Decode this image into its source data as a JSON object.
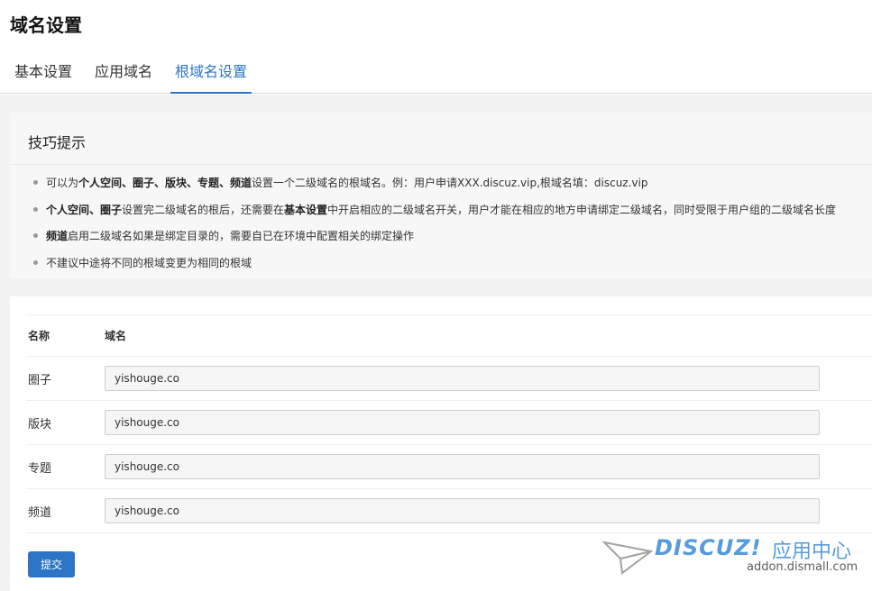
{
  "page": {
    "title": "域名设置"
  },
  "tabs": [
    {
      "label": "基本设置",
      "active": false
    },
    {
      "label": "应用域名",
      "active": false
    },
    {
      "label": "根域名设置",
      "active": true
    }
  ],
  "tips": {
    "title": "技巧提示",
    "items": [
      {
        "parts": [
          {
            "text": "可以为",
            "bold": false
          },
          {
            "text": "个人空间、圈子、版块、专题、频道",
            "bold": true
          },
          {
            "text": "设置一个二级域名的根域名。例：用户申请XXX.discuz.vip,根域名填：discuz.vip",
            "bold": false
          }
        ]
      },
      {
        "parts": [
          {
            "text": "个人空间、圈子",
            "bold": true
          },
          {
            "text": "设置完二级域名的根后，还需要在",
            "bold": false
          },
          {
            "text": "基本设置",
            "bold": true
          },
          {
            "text": "中开启相应的二级域名开关，用户才能在相应的地方申请绑定二级域名，同时受限于用户组的二级域名长度",
            "bold": false
          }
        ]
      },
      {
        "parts": [
          {
            "text": "频道",
            "bold": true
          },
          {
            "text": "启用二级域名如果是绑定目录的，需要自已在环境中配置相关的绑定操作",
            "bold": false
          }
        ]
      },
      {
        "parts": [
          {
            "text": "不建议中途将不同的根域变更为相同的根域",
            "bold": false
          }
        ]
      }
    ]
  },
  "form": {
    "headers": {
      "name": "名称",
      "domain": "域名"
    },
    "rows": [
      {
        "label": "圈子",
        "value": "yishouge.co"
      },
      {
        "label": "版块",
        "value": "yishouge.co"
      },
      {
        "label": "专题",
        "value": "yishouge.co"
      },
      {
        "label": "频道",
        "value": "yishouge.co"
      }
    ],
    "submit_label": "提交"
  },
  "watermark": {
    "brand": "DISCUZ!",
    "suffix": "应用中心",
    "url": "addon.dismall.com"
  },
  "colors": {
    "accent": "#2c75c6",
    "panel_bg": "#f2f2f2",
    "input_bg": "#f5f5f5"
  }
}
